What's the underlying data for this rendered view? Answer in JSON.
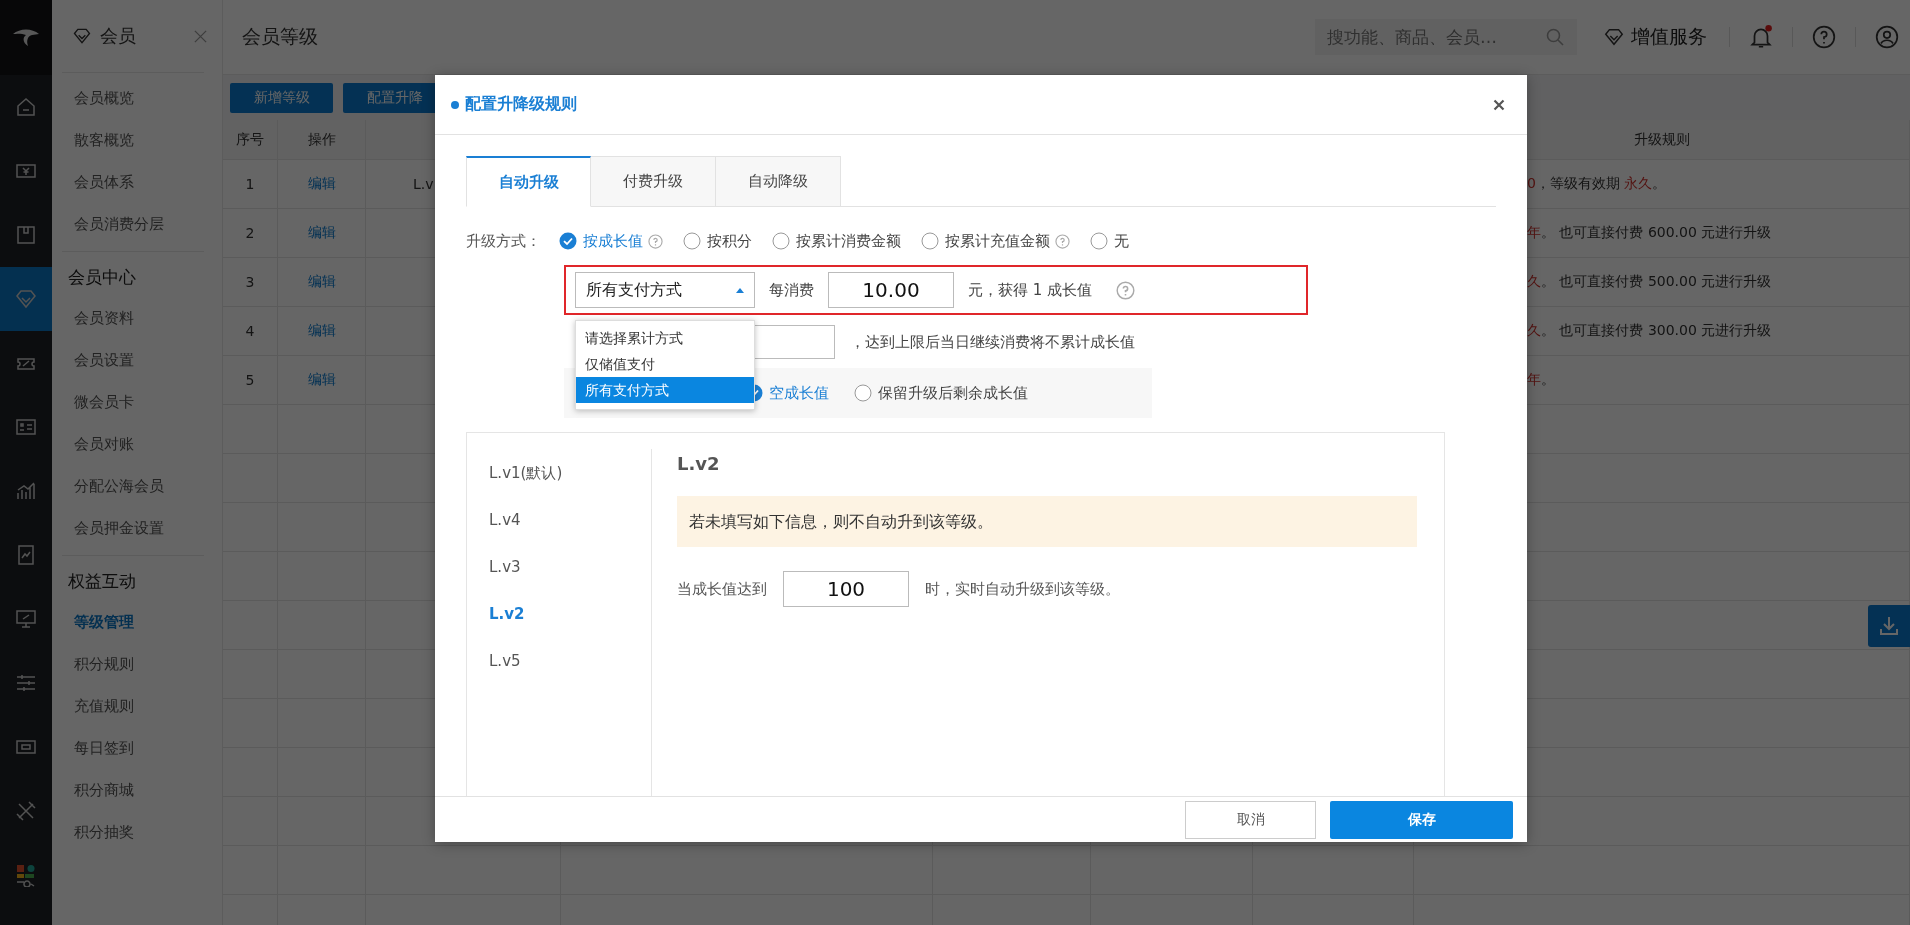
{
  "nav_rail": [
    {
      "selected": false
    },
    {
      "selected": false
    },
    {
      "selected": false
    },
    {
      "selected": true
    },
    {
      "selected": false
    },
    {
      "selected": false
    },
    {
      "selected": false
    },
    {
      "selected": false
    },
    {
      "selected": false
    },
    {
      "selected": false
    },
    {
      "selected": false
    },
    {
      "selected": false
    },
    {
      "selected": false
    }
  ],
  "sidebar": {
    "title": "会员",
    "groups": [
      {
        "items": [
          {
            "label": "会员概览",
            "selected": false
          },
          {
            "label": "散客概览",
            "selected": false
          },
          {
            "label": "会员体系",
            "selected": false
          },
          {
            "label": "会员消费分层",
            "selected": false
          }
        ]
      },
      {
        "heading": "会员中心",
        "items": [
          {
            "label": "会员资料",
            "selected": false
          },
          {
            "label": "会员设置",
            "selected": false
          },
          {
            "label": "微会员卡",
            "selected": false
          },
          {
            "label": "会员对账",
            "selected": false
          },
          {
            "label": "分配公海会员",
            "selected": false
          },
          {
            "label": "会员押金设置",
            "selected": false
          }
        ]
      },
      {
        "heading": "权益互动",
        "items": [
          {
            "label": "等级管理",
            "selected": true
          },
          {
            "label": "积分规则",
            "selected": false
          },
          {
            "label": "充值规则",
            "selected": false
          },
          {
            "label": "每日签到",
            "selected": false
          },
          {
            "label": "积分商城",
            "selected": false
          },
          {
            "label": "积分抽奖",
            "selected": false
          }
        ]
      }
    ]
  },
  "topbar": {
    "title": "会员等级",
    "search": {
      "placeholder": "搜功能、商品、会员…"
    },
    "service": "增值服务",
    "notification": true
  },
  "toolbar": {
    "buttons": [
      "新增等级",
      "配置升降"
    ]
  },
  "table": {
    "columns": [
      "序号",
      "操作",
      "升级规则"
    ],
    "rows": [
      {
        "index": "1",
        "action": "编辑",
        "column_3": "L.v",
        "rule": [
          {
            "text": "0",
            "emphasis": true
          },
          {
            "text": "，等级有效期 ",
            "emphasis": false
          },
          {
            "text": "永久",
            "emphasis": true
          },
          {
            "text": "。",
            "emphasis": false
          }
        ]
      },
      {
        "index": "2",
        "action": "编辑",
        "rule": [
          {
            "text": "年",
            "emphasis": true
          },
          {
            "text": "。 也可直接付费 600.00 元进行升级",
            "emphasis": false
          }
        ]
      },
      {
        "index": "3",
        "action": "编辑",
        "rule": [
          {
            "text": "久",
            "emphasis": true
          },
          {
            "text": "。 也可直接付费 500.00 元进行升级",
            "emphasis": false
          }
        ]
      },
      {
        "index": "4",
        "action": "编辑",
        "rule": [
          {
            "text": "久",
            "emphasis": true
          },
          {
            "text": "。 也可直接付费 300.00 元进行升级",
            "emphasis": false
          }
        ]
      },
      {
        "index": "5",
        "action": "编辑",
        "rule": [
          {
            "text": "年",
            "emphasis": true
          },
          {
            "text": "。",
            "emphasis": false
          }
        ]
      }
    ]
  },
  "modal": {
    "title": "配置升降级规则",
    "tabs": [
      {
        "label": "自动升级",
        "selected": true
      },
      {
        "label": "付费升级",
        "selected": false
      },
      {
        "label": "自动降级",
        "selected": false
      }
    ],
    "method_label": "升级方式：",
    "methods": [
      {
        "label": "按成长值",
        "selected": true,
        "help": true
      },
      {
        "label": "按积分",
        "selected": false,
        "help": false
      },
      {
        "label": "按累计消费金额",
        "selected": false,
        "help": false
      },
      {
        "label": "按累计充值金额",
        "selected": false,
        "help": true
      },
      {
        "label": "无",
        "selected": false,
        "help": false
      }
    ],
    "rule": {
      "highlighted": true,
      "select": "所有支付方式",
      "per_label": "每消费",
      "amount": "10.00",
      "suffix": "元，获得 1 成长值"
    },
    "dropdown": [
      {
        "label": "请选择累计方式",
        "selected": false
      },
      {
        "label": "仅储值支付",
        "selected": false
      },
      {
        "label": "所有支付方式",
        "selected": true
      }
    ],
    "limit_suffix": "，达到上限后当日继续消费将不累计成长值",
    "reset_options": [
      {
        "label": "空成长值",
        "selected": true
      },
      {
        "label": "保留升级后剩余成长值",
        "selected": false
      }
    ],
    "levels": [
      {
        "label": "L.v1(默认)",
        "selected": false
      },
      {
        "label": "L.v4",
        "selected": false
      },
      {
        "label": "L.v3",
        "selected": false
      },
      {
        "label": "L.v2",
        "selected": true
      },
      {
        "label": "L.v5",
        "selected": false
      }
    ],
    "detail": {
      "title": "L.v2",
      "notice": "若未填写如下信息，则不自动升到该等级。",
      "threshold_label": "当成长值达到",
      "threshold": "100",
      "threshold_suffix": "时，实时自动升级到该等级。"
    },
    "buttons": {
      "cancel": "取消",
      "save": "保存"
    }
  }
}
